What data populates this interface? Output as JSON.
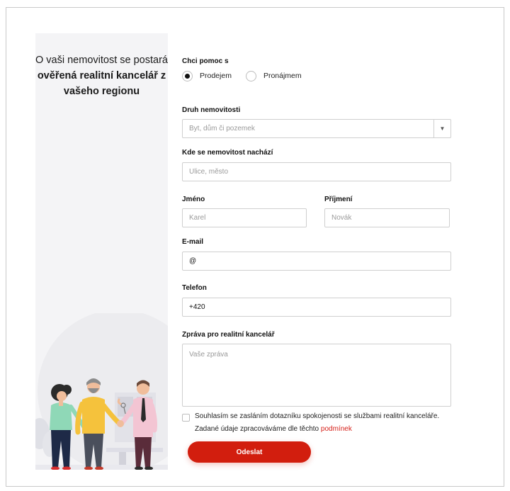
{
  "side": {
    "intro": "O vaši nemovitost se postará",
    "bold": "ověřená realitní kancelář z vašeho regionu"
  },
  "form": {
    "help_label": "Chci pomoc s",
    "radios": [
      {
        "label": "Prodejem",
        "checked": true
      },
      {
        "label": "Pronájmem",
        "checked": false
      }
    ],
    "property_type_label": "Druh nemovitosti",
    "property_type_value": "Byt, dům či pozemek",
    "location_label": "Kde se nemovitost nachází",
    "location_placeholder": "Ulice, město",
    "first_name_label": "Jméno",
    "first_name_placeholder": "Karel",
    "last_name_label": "Příjmení",
    "last_name_placeholder": "Novák",
    "email_label": "E-mail",
    "email_value": "@",
    "phone_label": "Telefon",
    "phone_value": "+420",
    "message_label": "Zpráva pro realitní kancelář",
    "message_placeholder": "Vaše zpráva",
    "consent_text": "Souhlasím se zasláním dotazníku spokojenosti se službami realitní kanceláře.",
    "gdpr_text": "Zadané údaje zpracováváme dle těchto",
    "gdpr_link": "podmínek",
    "submit_label": "Odeslat"
  },
  "colors": {
    "accent": "#d21e0e",
    "panel": "#f4f4f6"
  },
  "icons": {
    "select_arrow": "caret-down-icon"
  }
}
